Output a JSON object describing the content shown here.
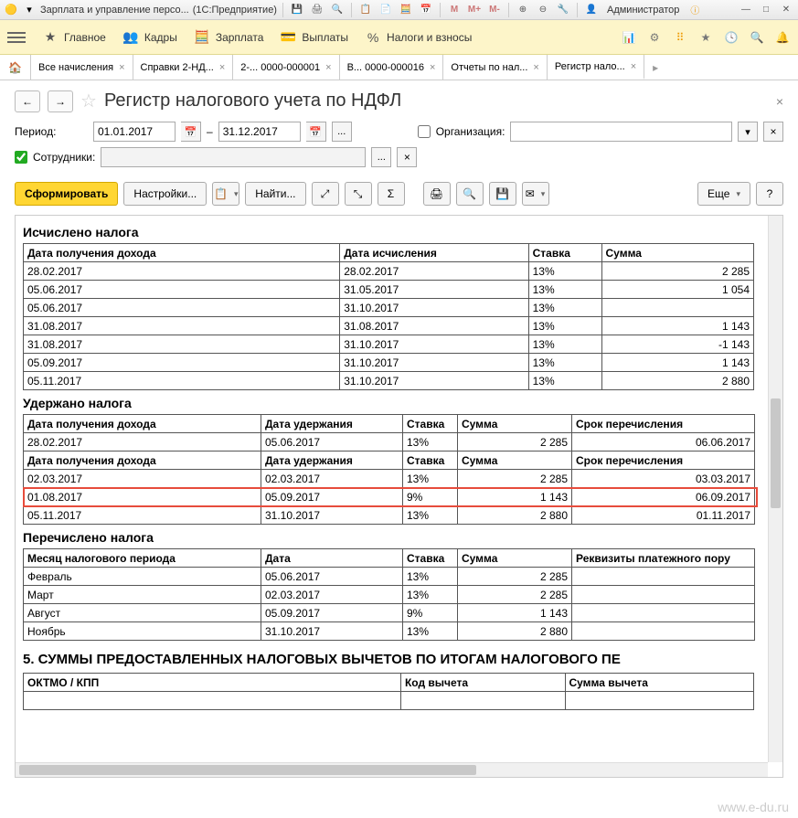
{
  "titlebar": {
    "app_title": "Зарплата и управление персо...",
    "platform": "(1С:Предприятие)",
    "m_plus": "M+",
    "m_minus": "M-",
    "m": "M",
    "user": "Администратор"
  },
  "nav": {
    "main": "Главное",
    "hr": "Кадры",
    "salary": "Зарплата",
    "payments": "Выплаты",
    "taxes": "Налоги и взносы"
  },
  "tabs": [
    {
      "label": "Все начисления"
    },
    {
      "label": "Справки 2-НД..."
    },
    {
      "label": "2-... 0000-000001"
    },
    {
      "label": "В... 0000-000016"
    },
    {
      "label": "Отчеты по нал..."
    },
    {
      "label": "Регистр нало...",
      "active": true
    }
  ],
  "page": {
    "title": "Регистр налогового учета по НДФЛ",
    "period_label": "Период:",
    "date_from": "01.01.2017",
    "date_to": "31.12.2017",
    "dash": "–",
    "org_label": "Организация:",
    "emp_label": "Сотрудники:"
  },
  "toolbar": {
    "form": "Сформировать",
    "settings": "Настройки...",
    "find": "Найти...",
    "more": "Еще",
    "help": "?"
  },
  "report": {
    "sect1": "Исчислено налога",
    "sect2": "Удержано налога",
    "sect3": "Перечислено налога",
    "big": "5. СУММЫ ПРЕДОСТАВЛЕННЫХ НАЛОГОВЫХ ВЫЧЕТОВ ПО ИТОГАМ НАЛОГОВОГО ПЕ",
    "h_date_income": "Дата получения дохода",
    "h_date_calc": "Дата исчисления",
    "h_date_hold": "Дата удержания",
    "h_rate": "Ставка",
    "h_sum": "Сумма",
    "h_due": "Срок перечисления",
    "h_month": "Месяц налогового периода",
    "h_date": "Дата",
    "h_req": "Реквизиты платежного пору",
    "h_oktmo": "ОКТМО / КПП",
    "h_code": "Код вычета",
    "h_sum_ded": "Сумма вычета",
    "t1": [
      [
        "28.02.2017",
        "28.02.2017",
        "13%",
        "2 285"
      ],
      [
        "05.06.2017",
        "31.05.2017",
        "13%",
        "1 054"
      ],
      [
        "05.06.2017",
        "31.10.2017",
        "13%",
        ""
      ],
      [
        "31.08.2017",
        "31.08.2017",
        "13%",
        "1 143"
      ],
      [
        "31.08.2017",
        "31.10.2017",
        "13%",
        "-1 143"
      ],
      [
        "05.09.2017",
        "31.10.2017",
        "13%",
        "1 143"
      ],
      [
        "05.11.2017",
        "31.10.2017",
        "13%",
        "2 880"
      ]
    ],
    "t2a": [
      [
        "28.02.2017",
        "05.06.2017",
        "13%",
        "2 285",
        "06.06.2017"
      ]
    ],
    "t2b": [
      [
        "02.03.2017",
        "02.03.2017",
        "13%",
        "2 285",
        "03.03.2017"
      ],
      [
        "01.08.2017",
        "05.09.2017",
        "9%",
        "1 143",
        "06.09.2017"
      ],
      [
        "05.11.2017",
        "31.10.2017",
        "13%",
        "2 880",
        "01.11.2017"
      ]
    ],
    "t3": [
      [
        "Февраль",
        "05.06.2017",
        "13%",
        "2 285",
        ""
      ],
      [
        "Март",
        "02.03.2017",
        "13%",
        "2 285",
        ""
      ],
      [
        "Август",
        "05.09.2017",
        "9%",
        "1 143",
        ""
      ],
      [
        "Ноябрь",
        "31.10.2017",
        "13%",
        "2 880",
        ""
      ]
    ]
  },
  "watermark": "www.e-du.ru"
}
